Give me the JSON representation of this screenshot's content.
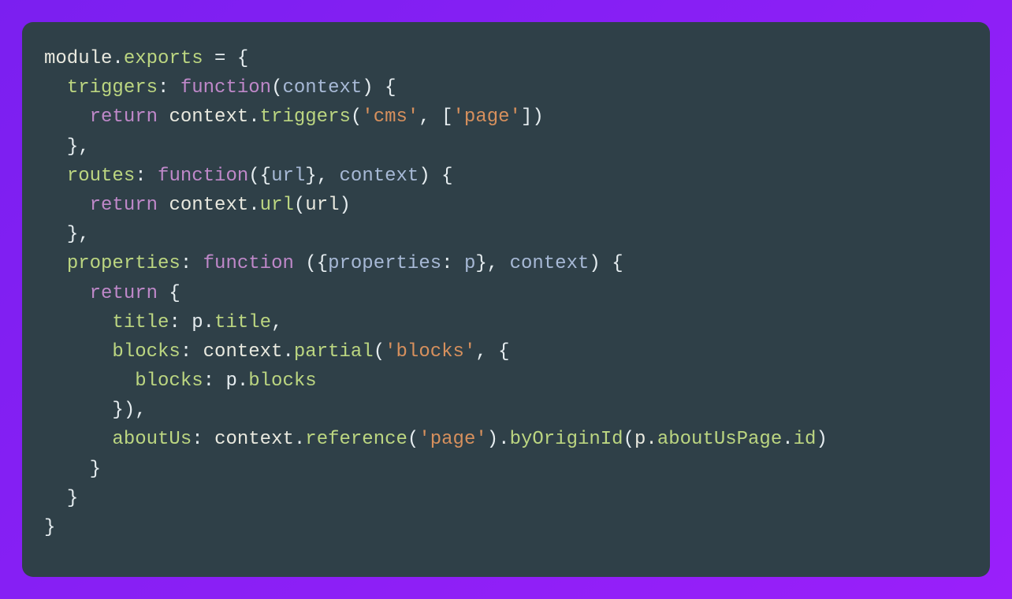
{
  "tokens": {
    "module": "module",
    "dot": ".",
    "exports": "exports",
    "eq_brace": " = {",
    "triggers": "triggers",
    "colon_sp": ": ",
    "function": "function",
    "lparen": "(",
    "rparen": ")",
    "context": "context",
    "sp_lbrace": " {",
    "return": "return",
    "sp": " ",
    "str_cms": "'cms'",
    "comma_sp": ", ",
    "lbracket": "[",
    "str_page": "'page'",
    "rbracket": "]",
    "rbrace_comma": "},",
    "routes": "routes",
    "lbrace": "{",
    "url": "url",
    "rbrace": "}",
    "properties": "properties",
    "p": "p",
    "title": "title",
    "colon_sp2": ": p.",
    "comma": ",",
    "blocks": "blocks",
    "partial": "partial",
    "str_blocks": "'blocks'",
    "rparen_comma": "),",
    "aboutUs": "aboutUs",
    "reference": "reference",
    "byOriginId": "byOriginId",
    "aboutUsPage": "aboutUsPage",
    "id": "id",
    "p_dot": "p.",
    "function_sp": "function "
  },
  "colors": {
    "bg_gradient_from": "#7b1ff0",
    "bg_gradient_to": "#9a1ffa",
    "code_bg": "#2f4048",
    "text": "#e6edf0",
    "keyword": "#bf88c9",
    "property": "#bcd681",
    "param": "#a7b9d6",
    "string": "#d7905d"
  }
}
